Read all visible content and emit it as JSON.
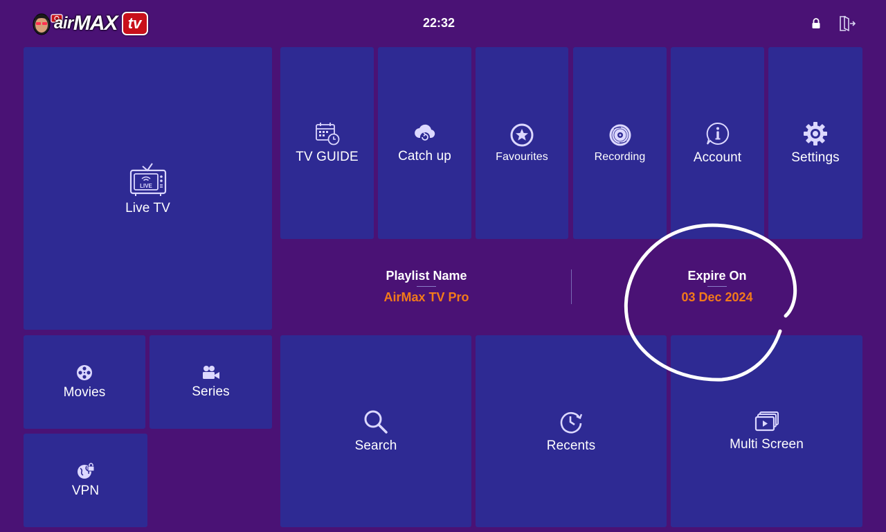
{
  "header": {
    "logo": {
      "air": "air",
      "max": "MAX",
      "tv": "tv"
    },
    "clock": "22:32",
    "lock_icon": "lock-icon",
    "exit_icon": "logout-icon"
  },
  "tiles": {
    "live_tv": "Live TV",
    "tv_guide": "TV GUIDE",
    "catch_up": "Catch up",
    "favourites": "Favourites",
    "recording": "Recording",
    "account": "Account",
    "settings": "Settings",
    "movies": "Movies",
    "series": "Series",
    "vpn": "VPN",
    "search": "Search",
    "recents": "Recents",
    "multi_screen": "Multi Screen"
  },
  "live_badge": "LIVE",
  "info": {
    "playlist_label": "Playlist Name",
    "playlist_value": "AirMax TV Pro",
    "expire_label": "Expire On",
    "expire_value": "03 Dec 2024"
  },
  "colors": {
    "background": "#4a1275",
    "tile": "#2e2a93",
    "accent": "#f27a1a",
    "icon": "#dcd8ff"
  }
}
